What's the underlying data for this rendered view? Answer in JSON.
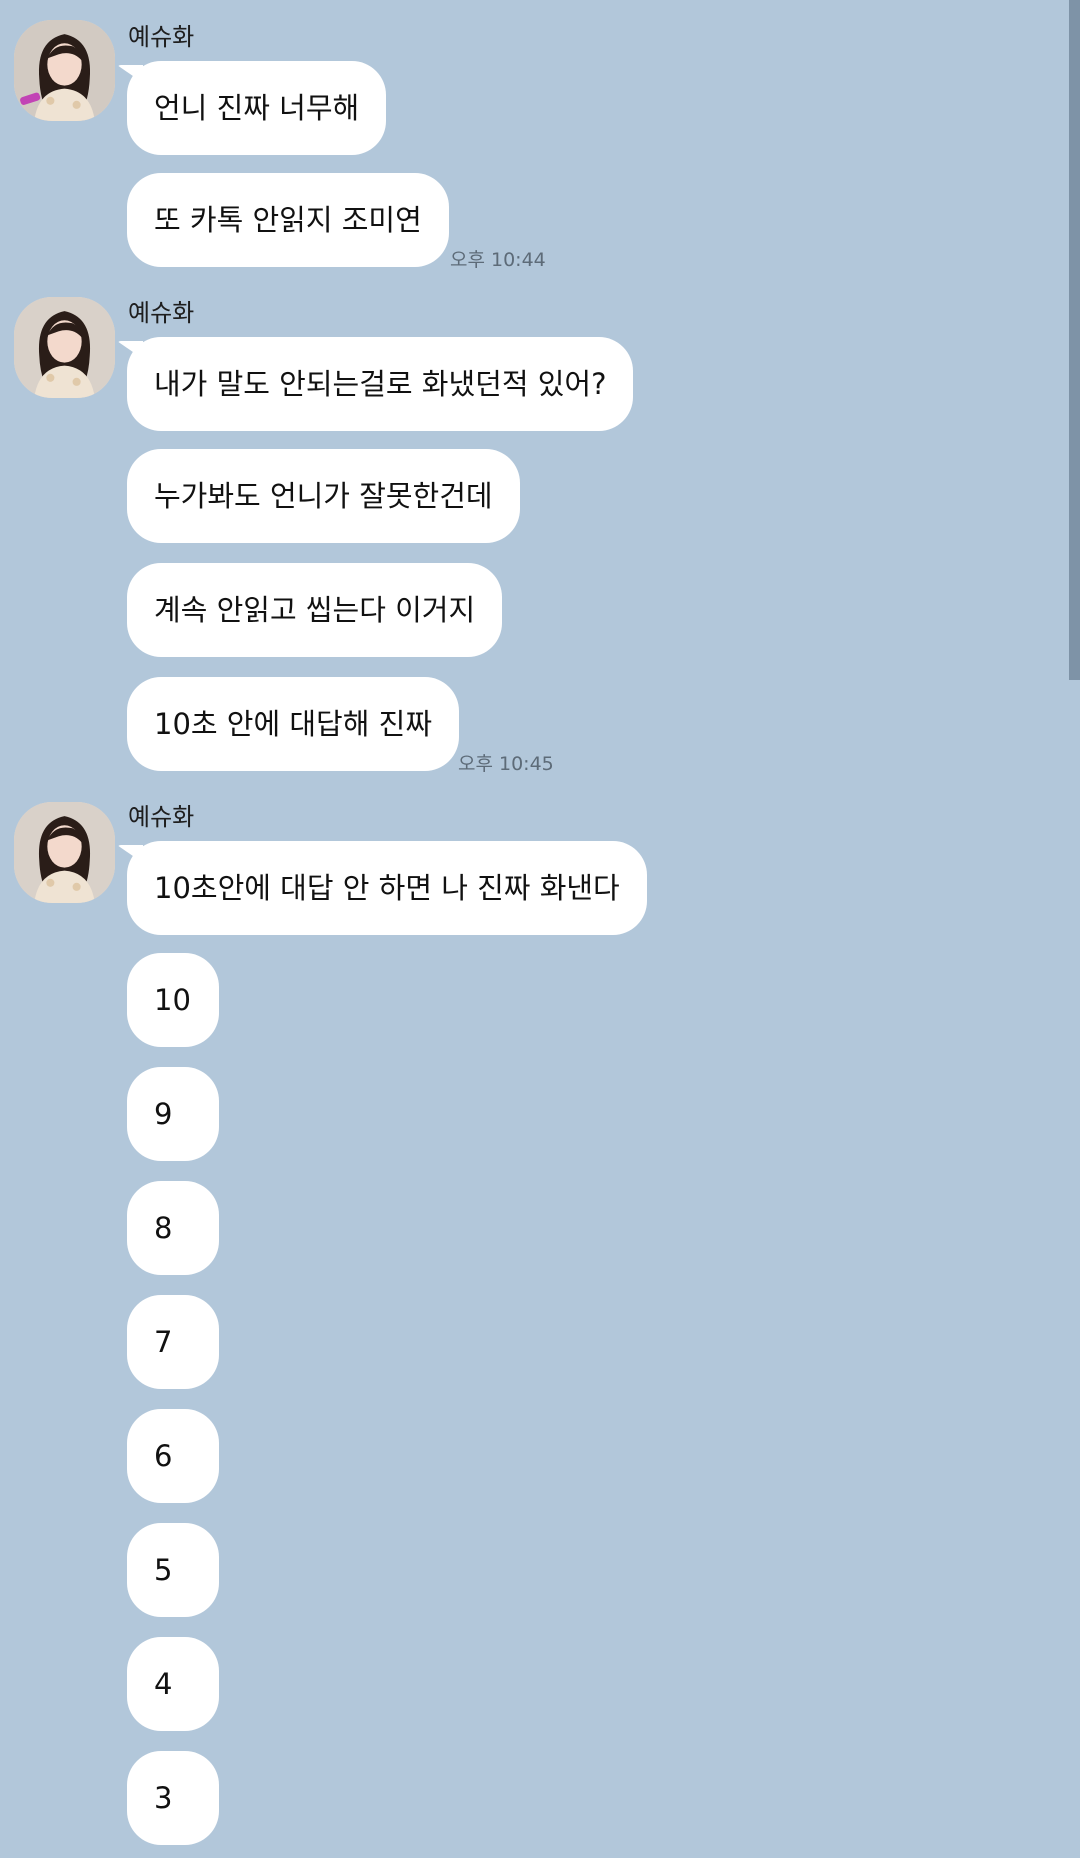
{
  "sender_name": "예슈화",
  "groups": [
    {
      "messages": [
        "언니 진짜 너무해",
        "또 카톡 안읽지 조미연"
      ],
      "time": "오후 10:44"
    },
    {
      "messages": [
        "내가 말도 안되는걸로 화냈던적 있어?",
        "누가봐도 언니가 잘못한건데",
        "계속 안읽고 씹는다 이거지",
        "10초 안에 대답해 진짜"
      ],
      "time": "오후 10:45"
    },
    {
      "messages": [
        "10초안에 대답 안 하면 나 진짜 화낸다",
        "10",
        "9",
        "8",
        "7",
        "6",
        "5",
        "4",
        "3"
      ]
    }
  ],
  "colors": {
    "background": "#b2c7da",
    "bubble": "#ffffff",
    "timestamp": "#5d6b78",
    "scrollbar": "#7e93a7"
  }
}
